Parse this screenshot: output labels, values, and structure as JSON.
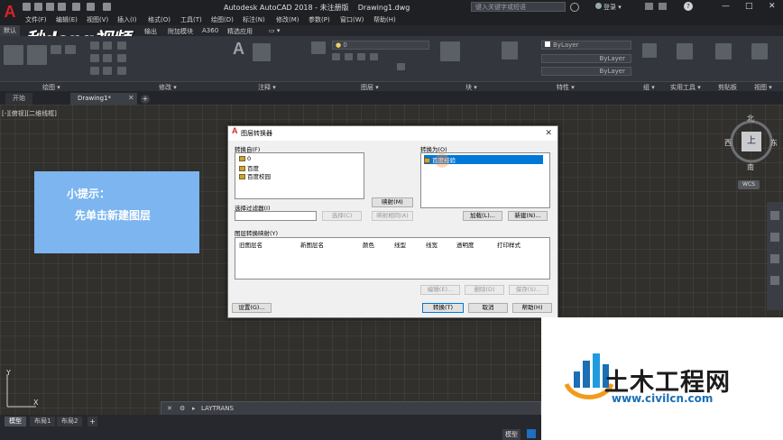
{
  "titlebar": {
    "title": "Autodesk AutoCAD 2018 - 未注册版",
    "filename": "Drawing1.dwg",
    "search_placeholder": "键入关键字或短语",
    "login": "登录"
  },
  "menubar": [
    "文件(F)",
    "编辑(E)",
    "视图(V)",
    "插入(I)",
    "格式(O)",
    "工具(T)",
    "绘图(D)",
    "标注(N)",
    "修改(M)",
    "参数(P)",
    "窗口(W)",
    "帮助(H)"
  ],
  "ribbon_tabs": [
    "默认",
    "插入",
    "注释",
    "参数化",
    "视图",
    "管理",
    "输出",
    "附加模块",
    "A360",
    "精选应用"
  ],
  "ribbon_controls": {
    "layer_combo": "0",
    "color_combo": "ByLayer",
    "linetype_combo": "ByLayer",
    "lineweight_combo": "ByLayer"
  },
  "panels": [
    "绘图 ▾",
    "修改 ▾",
    "注释 ▾",
    "图层 ▾",
    "块 ▾",
    "特性 ▾",
    "组 ▾",
    "实用工具 ▾",
    "剪贴板",
    "视图 ▾"
  ],
  "doc_tabs": [
    "开始",
    "Drawing1*"
  ],
  "viewport_label": "[-][俯视][二维线框]",
  "watermark_top": "秒dong视频",
  "tip": {
    "line1": "小提示：",
    "line2": "先单击新建图层"
  },
  "compass": {
    "north": "北",
    "south": "南",
    "east": "东",
    "west": "西",
    "top": "上",
    "wcs": "WCS"
  },
  "ucs": {
    "x": "X",
    "y": "Y"
  },
  "dialog": {
    "title": "图层转换器",
    "convert_from_label": "转换自(F)",
    "convert_from_items": [
      "0",
      "百度",
      "百度校园"
    ],
    "convert_to_label": "转换为(O)",
    "convert_to_items": [
      "百度经验"
    ],
    "selection_filter_label": "选择过滤器(I)",
    "select_button": "选择(C)",
    "map_button": "映射(M)",
    "map_same_button": "映射相同(A)",
    "load_button": "加载(L)...",
    "new_button": "新建(N)...",
    "mapping_label": "图层转换映射(Y)",
    "columns": [
      "旧图层名",
      "新图层名",
      "颜色",
      "线型",
      "线宽",
      "透明度",
      "打印样式"
    ],
    "edit_button": "编辑(E)...",
    "delete_button": "删除(D)",
    "save_button": "保存(S)...",
    "settings_button": "设置(G)...",
    "translate_button": "转换(T)",
    "cancel_button": "取消",
    "help_button": "帮助(H)"
  },
  "command_line": "LAYTRANS",
  "layout_tabs": [
    "模型",
    "布局1",
    "布局2"
  ],
  "status_model": "模型",
  "corner_logo": {
    "name": "土木工程网",
    "url": "www.civilcn.com"
  }
}
